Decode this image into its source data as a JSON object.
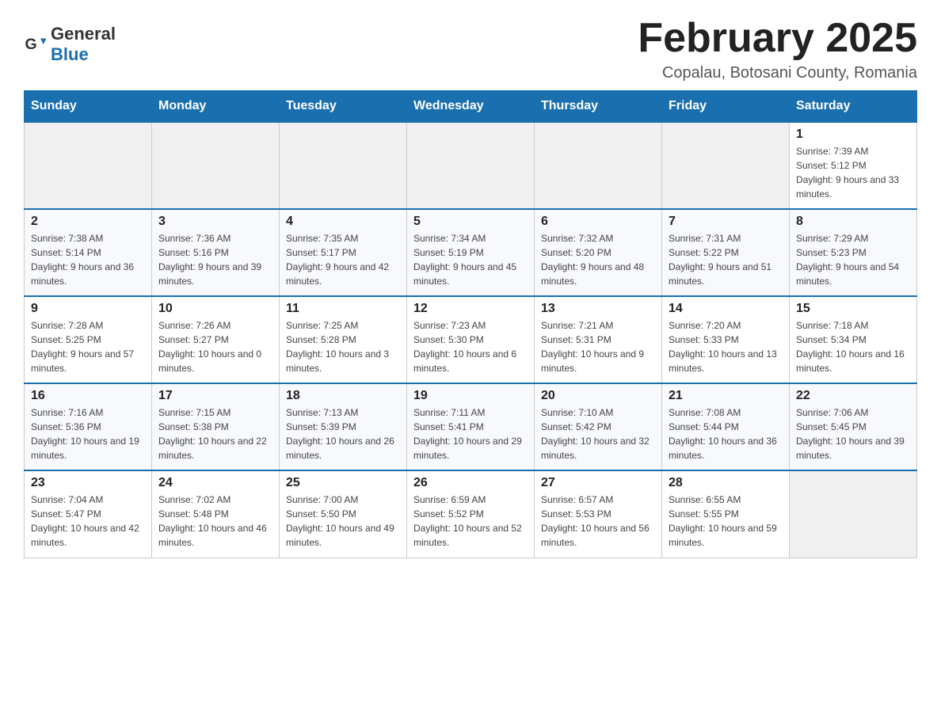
{
  "header": {
    "logo_general": "General",
    "logo_blue": "Blue",
    "month_title": "February 2025",
    "subtitle": "Copalau, Botosani County, Romania"
  },
  "weekdays": [
    "Sunday",
    "Monday",
    "Tuesday",
    "Wednesday",
    "Thursday",
    "Friday",
    "Saturday"
  ],
  "weeks": [
    [
      {
        "day": "",
        "info": ""
      },
      {
        "day": "",
        "info": ""
      },
      {
        "day": "",
        "info": ""
      },
      {
        "day": "",
        "info": ""
      },
      {
        "day": "",
        "info": ""
      },
      {
        "day": "",
        "info": ""
      },
      {
        "day": "1",
        "info": "Sunrise: 7:39 AM\nSunset: 5:12 PM\nDaylight: 9 hours and 33 minutes."
      }
    ],
    [
      {
        "day": "2",
        "info": "Sunrise: 7:38 AM\nSunset: 5:14 PM\nDaylight: 9 hours and 36 minutes."
      },
      {
        "day": "3",
        "info": "Sunrise: 7:36 AM\nSunset: 5:16 PM\nDaylight: 9 hours and 39 minutes."
      },
      {
        "day": "4",
        "info": "Sunrise: 7:35 AM\nSunset: 5:17 PM\nDaylight: 9 hours and 42 minutes."
      },
      {
        "day": "5",
        "info": "Sunrise: 7:34 AM\nSunset: 5:19 PM\nDaylight: 9 hours and 45 minutes."
      },
      {
        "day": "6",
        "info": "Sunrise: 7:32 AM\nSunset: 5:20 PM\nDaylight: 9 hours and 48 minutes."
      },
      {
        "day": "7",
        "info": "Sunrise: 7:31 AM\nSunset: 5:22 PM\nDaylight: 9 hours and 51 minutes."
      },
      {
        "day": "8",
        "info": "Sunrise: 7:29 AM\nSunset: 5:23 PM\nDaylight: 9 hours and 54 minutes."
      }
    ],
    [
      {
        "day": "9",
        "info": "Sunrise: 7:28 AM\nSunset: 5:25 PM\nDaylight: 9 hours and 57 minutes."
      },
      {
        "day": "10",
        "info": "Sunrise: 7:26 AM\nSunset: 5:27 PM\nDaylight: 10 hours and 0 minutes."
      },
      {
        "day": "11",
        "info": "Sunrise: 7:25 AM\nSunset: 5:28 PM\nDaylight: 10 hours and 3 minutes."
      },
      {
        "day": "12",
        "info": "Sunrise: 7:23 AM\nSunset: 5:30 PM\nDaylight: 10 hours and 6 minutes."
      },
      {
        "day": "13",
        "info": "Sunrise: 7:21 AM\nSunset: 5:31 PM\nDaylight: 10 hours and 9 minutes."
      },
      {
        "day": "14",
        "info": "Sunrise: 7:20 AM\nSunset: 5:33 PM\nDaylight: 10 hours and 13 minutes."
      },
      {
        "day": "15",
        "info": "Sunrise: 7:18 AM\nSunset: 5:34 PM\nDaylight: 10 hours and 16 minutes."
      }
    ],
    [
      {
        "day": "16",
        "info": "Sunrise: 7:16 AM\nSunset: 5:36 PM\nDaylight: 10 hours and 19 minutes."
      },
      {
        "day": "17",
        "info": "Sunrise: 7:15 AM\nSunset: 5:38 PM\nDaylight: 10 hours and 22 minutes."
      },
      {
        "day": "18",
        "info": "Sunrise: 7:13 AM\nSunset: 5:39 PM\nDaylight: 10 hours and 26 minutes."
      },
      {
        "day": "19",
        "info": "Sunrise: 7:11 AM\nSunset: 5:41 PM\nDaylight: 10 hours and 29 minutes."
      },
      {
        "day": "20",
        "info": "Sunrise: 7:10 AM\nSunset: 5:42 PM\nDaylight: 10 hours and 32 minutes."
      },
      {
        "day": "21",
        "info": "Sunrise: 7:08 AM\nSunset: 5:44 PM\nDaylight: 10 hours and 36 minutes."
      },
      {
        "day": "22",
        "info": "Sunrise: 7:06 AM\nSunset: 5:45 PM\nDaylight: 10 hours and 39 minutes."
      }
    ],
    [
      {
        "day": "23",
        "info": "Sunrise: 7:04 AM\nSunset: 5:47 PM\nDaylight: 10 hours and 42 minutes."
      },
      {
        "day": "24",
        "info": "Sunrise: 7:02 AM\nSunset: 5:48 PM\nDaylight: 10 hours and 46 minutes."
      },
      {
        "day": "25",
        "info": "Sunrise: 7:00 AM\nSunset: 5:50 PM\nDaylight: 10 hours and 49 minutes."
      },
      {
        "day": "26",
        "info": "Sunrise: 6:59 AM\nSunset: 5:52 PM\nDaylight: 10 hours and 52 minutes."
      },
      {
        "day": "27",
        "info": "Sunrise: 6:57 AM\nSunset: 5:53 PM\nDaylight: 10 hours and 56 minutes."
      },
      {
        "day": "28",
        "info": "Sunrise: 6:55 AM\nSunset: 5:55 PM\nDaylight: 10 hours and 59 minutes."
      },
      {
        "day": "",
        "info": ""
      }
    ]
  ]
}
